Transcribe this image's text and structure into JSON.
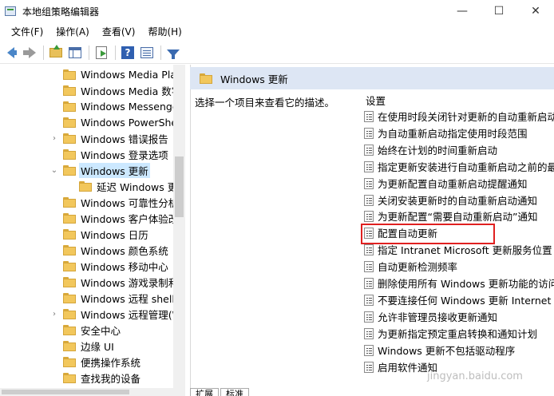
{
  "window": {
    "title": "本地组策略编辑器",
    "controls": {
      "minimize": "—",
      "maximize": "☐",
      "close": "✕"
    }
  },
  "menu": [
    "文件(F)",
    "操作(A)",
    "查看(V)",
    "帮助(H)"
  ],
  "toolbar": {
    "icons": [
      "back-arrow-icon",
      "forward-arrow-icon",
      "up-folder-icon",
      "show-hide-tree-icon",
      "export-list-icon",
      "help-icon",
      "properties-icon",
      "filter-icon"
    ],
    "help_glyph": "?"
  },
  "tree": {
    "items": [
      {
        "label": "Windows Media Pla",
        "expandable": false
      },
      {
        "label": "Windows Media 数字",
        "expandable": false
      },
      {
        "label": "Windows Messenger",
        "expandable": false
      },
      {
        "label": "Windows PowerShe",
        "expandable": false
      },
      {
        "label": "Windows 错误报告",
        "expandable": true,
        "expander": "›"
      },
      {
        "label": "Windows 登录选项",
        "expandable": false
      },
      {
        "label": "Windows 更新",
        "expandable": true,
        "expander": "⌄",
        "selected": true
      },
      {
        "label": "延迟 Windows 更",
        "expandable": false,
        "child": true
      },
      {
        "label": "Windows 可靠性分析",
        "expandable": false
      },
      {
        "label": "Windows 客户体验改",
        "expandable": false
      },
      {
        "label": "Windows 日历",
        "expandable": false
      },
      {
        "label": "Windows 颜色系统",
        "expandable": false
      },
      {
        "label": "Windows 移动中心",
        "expandable": false
      },
      {
        "label": "Windows 游戏录制和",
        "expandable": false
      },
      {
        "label": "Windows 远程 shell",
        "expandable": false
      },
      {
        "label": "Windows 远程管理(W",
        "expandable": true,
        "expander": "›"
      },
      {
        "label": "安全中心",
        "expandable": false
      },
      {
        "label": "边缘 UI",
        "expandable": false
      },
      {
        "label": "便携操作系统",
        "expandable": false
      },
      {
        "label": "查找我的设备",
        "expandable": false
      }
    ]
  },
  "right": {
    "header_title": "Windows 更新",
    "description": "选择一个项目来查看它的描述。",
    "column_header": "设置",
    "settings": [
      "在使用时段关闭针对更新的自动重新启动",
      "为自动重新启动指定使用时段范围",
      "始终在计划的时间重新启动",
      "指定更新安装进行自动重新启动之前的最后",
      "为更新配置自动重新启动提醒通知",
      "关闭安装更新时的自动重新启动通知",
      "为更新配置“需要自动重新启动”通知",
      "配置自动更新",
      "指定 Intranet Microsoft 更新服务位置",
      "自动更新检测频率",
      "删除使用所有 Windows 更新功能的访问权",
      "不要连接任何 Windows 更新 Internet 位",
      "允许非管理员接收更新通知",
      "为更新指定预定重启转换和通知计划",
      "Windows 更新不包括驱动程序",
      "启用软件通知"
    ],
    "highlighted": "配置自动更新"
  },
  "bottom_tabs": [
    "扩展",
    "标准"
  ],
  "watermark": "jingyan.baidu.com"
}
